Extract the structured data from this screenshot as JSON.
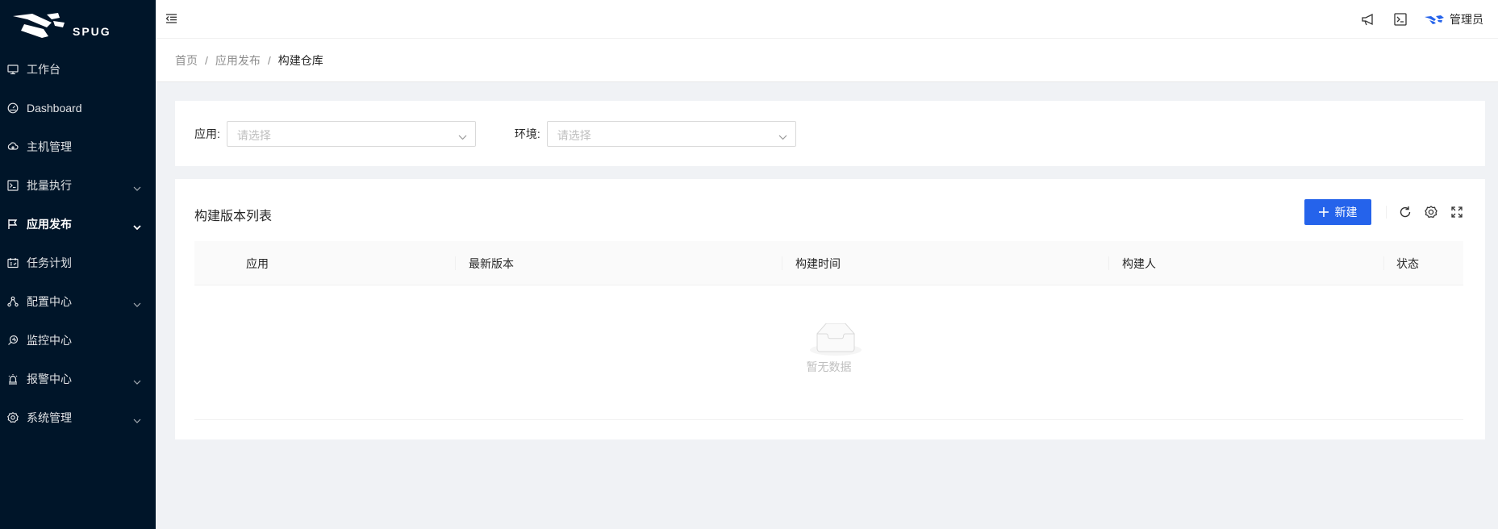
{
  "brand": {
    "logo_text": "SPUG"
  },
  "sidebar": {
    "items": [
      {
        "label": "工作台",
        "icon": "desktop-icon",
        "has_children": false,
        "active": false
      },
      {
        "label": "Dashboard",
        "icon": "dashboard-icon",
        "has_children": false,
        "active": false
      },
      {
        "label": "主机管理",
        "icon": "cloud-server-icon",
        "has_children": false,
        "active": false
      },
      {
        "label": "批量执行",
        "icon": "code-icon",
        "has_children": true,
        "active": false
      },
      {
        "label": "应用发布",
        "icon": "flag-icon",
        "has_children": true,
        "active": true
      },
      {
        "label": "任务计划",
        "icon": "schedule-icon",
        "has_children": false,
        "active": false
      },
      {
        "label": "配置中心",
        "icon": "deployment-unit-icon",
        "has_children": true,
        "active": false
      },
      {
        "label": "监控中心",
        "icon": "monitor-icon",
        "has_children": false,
        "active": false
      },
      {
        "label": "报警中心",
        "icon": "alert-icon",
        "has_children": true,
        "active": false
      },
      {
        "label": "系统管理",
        "icon": "setting-icon",
        "has_children": true,
        "active": false
      }
    ]
  },
  "header": {
    "user_name": "管理员"
  },
  "breadcrumb": {
    "home": "首页",
    "parent": "应用发布",
    "current": "构建仓库"
  },
  "filters": {
    "app_label": "应用:",
    "app_placeholder": "请选择",
    "env_label": "环境:",
    "env_placeholder": "请选择"
  },
  "table": {
    "title": "构建版本列表",
    "new_button": "新建",
    "columns": [
      "应用",
      "最新版本",
      "构建时间",
      "构建人",
      "状态"
    ],
    "rows": [],
    "empty_text": "暂无数据"
  },
  "colors": {
    "sidebar_bg": "#001529",
    "primary": "#2563eb"
  }
}
